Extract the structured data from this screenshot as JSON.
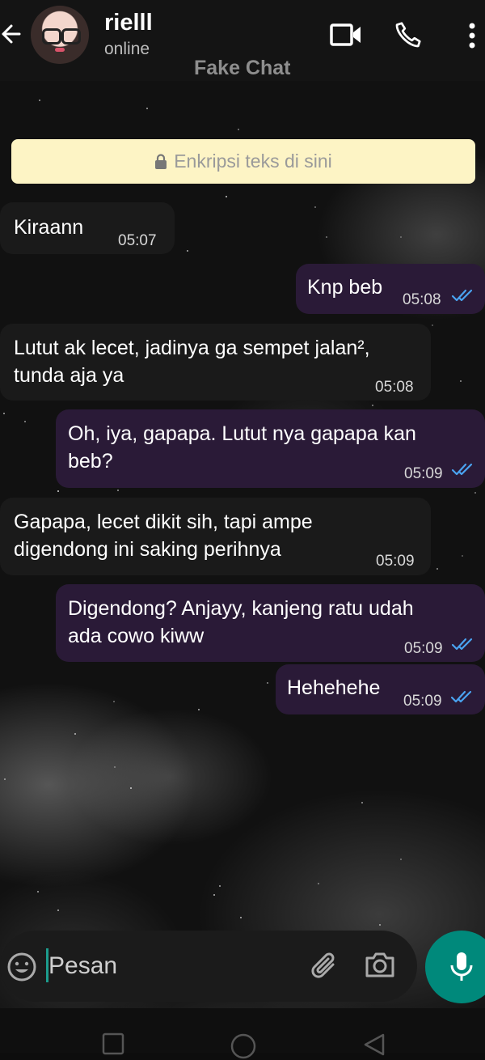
{
  "header": {
    "contact_name": "rielll",
    "contact_status": "online",
    "app_title": "Fake Chat",
    "icons": [
      "back-arrow-icon",
      "video-call-icon",
      "phone-icon",
      "more-vert-icon"
    ]
  },
  "encryption_notice": {
    "icon": "lock-icon",
    "text": "Enkripsi teks di sini",
    "background_color": "#fdf4c5"
  },
  "messages": [
    {
      "direction": "in",
      "lines": [
        "Kiraann"
      ],
      "time": "05:07"
    },
    {
      "direction": "out",
      "lines": [
        "Knp beb"
      ],
      "time": "05:08",
      "read": true
    },
    {
      "direction": "in",
      "lines": [
        "Lutut ak lecet, jadinya ga sempet jalan²,",
        "tunda aja ya"
      ],
      "time": "05:08"
    },
    {
      "direction": "out",
      "lines": [
        "Oh, iya, gapapa. Lutut nya gapapa kan",
        "beb?"
      ],
      "time": "05:09",
      "read": true
    },
    {
      "direction": "in",
      "lines": [
        "Gapapa, lecet dikit sih, tapi ampe",
        "digendong ini saking perihnya"
      ],
      "time": "05:09"
    },
    {
      "direction": "out",
      "lines": [
        "Digendong? Anjayy, kanjeng ratu udah",
        "ada cowo kiww"
      ],
      "time": "05:09",
      "read": true
    },
    {
      "direction": "out",
      "lines": [
        "Hehehehe"
      ],
      "time": "05:09",
      "read": true
    }
  ],
  "composer": {
    "placeholder": "Pesan",
    "value": "",
    "icons": [
      "emoji-icon",
      "attach-icon",
      "camera-icon",
      "mic-icon"
    ]
  },
  "colors": {
    "incoming_bubble": "#1a1a1a",
    "outgoing_bubble": "#2a1a37",
    "read_ticks": "#4aa3f0",
    "mic_button": "#00897b"
  },
  "nav_bar": {
    "icons": [
      "recents-square-icon",
      "home-circle-icon",
      "back-triangle-icon"
    ]
  }
}
